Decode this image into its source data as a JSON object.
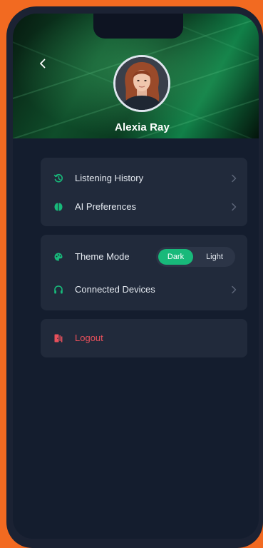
{
  "profile": {
    "name": "Alexia Ray"
  },
  "menu_primary": [
    {
      "label": "Listening History",
      "icon": "history-icon"
    },
    {
      "label": "AI Preferences",
      "icon": "brain-icon"
    }
  ],
  "theme": {
    "label": "Theme Mode",
    "icon": "palette-icon",
    "options": [
      "Dark",
      "Light"
    ],
    "selected": "Dark"
  },
  "devices": {
    "label": "Connected Devices",
    "icon": "headphones-icon"
  },
  "logout": {
    "label": "Logout",
    "icon": "logout-icon"
  },
  "colors": {
    "accent": "#18b97a",
    "danger": "#e8505b",
    "frame": "#f26a21",
    "card": "#212a3b",
    "screen_bg": "#141d2e"
  }
}
